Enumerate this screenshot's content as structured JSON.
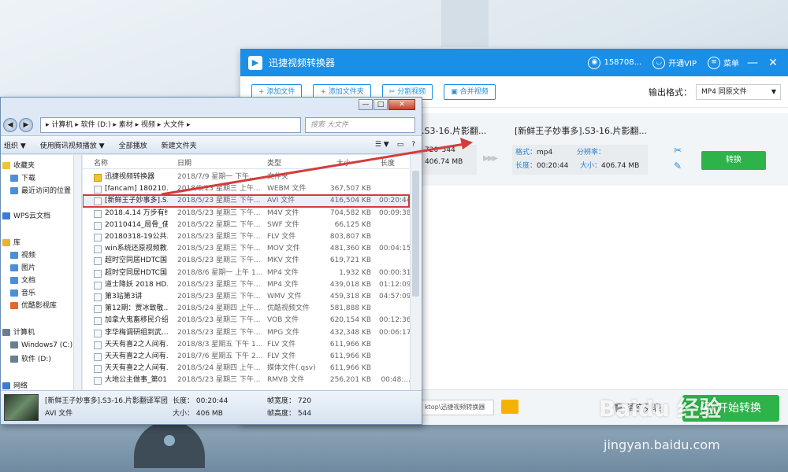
{
  "app": {
    "title": "迅捷视频转换器",
    "user": "158708...",
    "vip": "开通VIP",
    "menu": "菜单",
    "toolbar": {
      "add_file": "+ 添加文件",
      "add_folder": "+ 添加文件夹",
      "split": "分割视频",
      "merge": "合并视频",
      "output_label": "输出格式：",
      "output_value": "MP4  同原文件"
    },
    "source": {
      "name": ".S3-16.片影翻...",
      "resolution": "720*544",
      "size": "406.74 MB"
    },
    "target": {
      "name": "[新鲜王子妙事多].S3-16.片影翻...",
      "format_label": "格式：",
      "format_value": "mp4",
      "res_label": "分辨率：",
      "duration_label": "长度：",
      "duration_value": "00:20:44",
      "size_label": "大小：",
      "size_value": "406.74 MB"
    },
    "convert": "转换",
    "path": "ktop\\迅捷视频转换器",
    "clear": "清空列表",
    "start": "开始转换"
  },
  "explorer": {
    "address": "▸ 计算机 ▸ 软件 (D:) ▸ 素材 ▸ 视频 ▸ 大文件 ▸",
    "search_placeholder": "搜索 大文件",
    "commands": [
      "组织 ▼",
      "使用腾讯视频播放 ▼",
      "全部播放",
      "新建文件夹"
    ],
    "nav": [
      "收藏夹",
      "下载",
      "最近访问的位置",
      "WPS云文档",
      "库",
      "视频",
      "图片",
      "文档",
      "音乐",
      "优酷影视库",
      "计算机",
      "Windows7 (C:)",
      "软件 (D:)",
      "网络"
    ],
    "columns": {
      "name": "名称",
      "date": "日期",
      "type": "类型",
      "size": "大小",
      "duration": "长度"
    },
    "files": [
      {
        "name": "迅捷视频转换器",
        "date": "2018/7/9 星期一 下午...",
        "type": "文件夹",
        "size": "",
        "duration": ""
      },
      {
        "name": "[fancam] 180210...",
        "date": "2018/5/23 星期三 上午...",
        "type": "WEBM 文件",
        "size": "367,507 KB",
        "duration": ""
      },
      {
        "name": "[新鲜王子妙事多].S...",
        "date": "2018/5/23 星期三 下午...",
        "type": "AVI 文件",
        "size": "416,504 KB",
        "duration": "00:20:44"
      },
      {
        "name": "2018.4.14 万步有约",
        "date": "2018/5/23 星期三 下午...",
        "type": "M4V 文件",
        "size": "704,582 KB",
        "duration": "00:09:38"
      },
      {
        "name": "20110414_局骨_使...",
        "date": "2018/5/22 星期二 下午...",
        "type": "SWF 文件",
        "size": "66,125 KB",
        "duration": ""
      },
      {
        "name": "20180318-19公共...",
        "date": "2018/5/23 星期三 下午...",
        "type": "FLV 文件",
        "size": "803,807 KB",
        "duration": ""
      },
      {
        "name": "win系统还原视频教...",
        "date": "2018/5/23 星期三 下午...",
        "type": "MOV 文件",
        "size": "481,360 KB",
        "duration": "00:04:15"
      },
      {
        "name": "超时空同居HDTC国...",
        "date": "2018/5/23 星期三 下午...",
        "type": "MKV 文件",
        "size": "619,721 KB",
        "duration": ""
      },
      {
        "name": "超时空同居HDTC国...",
        "date": "2018/8/6 星期一 上午 1...",
        "type": "MP4 文件",
        "size": "1,932 KB",
        "duration": "00:00:31"
      },
      {
        "name": "道士降妖 2018 HD...",
        "date": "2018/5/23 星期三 下午...",
        "type": "MP4 文件",
        "size": "439,018 KB",
        "duration": "01:12:09"
      },
      {
        "name": "第3站第3讲",
        "date": "2018/5/23 星期三 下午...",
        "type": "WMV 文件",
        "size": "459,318 KB",
        "duration": "04:57:09"
      },
      {
        "name": "第12期：贾冰致敬...",
        "date": "2018/5/24 星期四 上午...",
        "type": "优酷视频文件",
        "size": "581,888 KB",
        "duration": ""
      },
      {
        "name": "加拿大鬼畜移民介绍",
        "date": "2018/5/23 星期三 下午...",
        "type": "VOB 文件",
        "size": "620,154 KB",
        "duration": "00:12:36"
      },
      {
        "name": "李华梅调研组到武...",
        "date": "2018/5/23 星期三 下午...",
        "type": "MPG 文件",
        "size": "432,348 KB",
        "duration": "00:06:17"
      },
      {
        "name": "天天有喜2之人间有...",
        "date": "2018/8/3 星期五 下午 1...",
        "type": "FLV 文件",
        "size": "611,966 KB",
        "duration": ""
      },
      {
        "name": "天天有喜2之人间有...",
        "date": "2018/7/6 星期五 下午 2...",
        "type": "FLV 文件",
        "size": "611,966 KB",
        "duration": ""
      },
      {
        "name": "天天有喜2之人间有...",
        "date": "2018/5/24 星期四 上午...",
        "type": "媒体文件(.qsv)",
        "size": "611,966 KB",
        "duration": ""
      },
      {
        "name": "大地公主做事_第01...",
        "date": "2018/5/23 星期三 下午...",
        "type": "RMVB 文件",
        "size": "256,201 KB",
        "duration": "00:48:..."
      }
    ],
    "details": {
      "name": "[新鲜王子妙事多].S3-16.片影翻译军团",
      "type": "AVI 文件",
      "duration_label": "长度：",
      "duration": "00:20:44",
      "size_label": "大小：",
      "size": "406 MB",
      "width_label": "帧宽度：",
      "width": "720",
      "height_label": "帧高度：",
      "height": "544"
    }
  },
  "watermark": {
    "brand": "Baidu 经验",
    "url": "jingyan.baidu.com"
  },
  "colors": {
    "accent": "#1a8fe8",
    "green": "#2eb34a",
    "highlight": "#d43b3b"
  }
}
